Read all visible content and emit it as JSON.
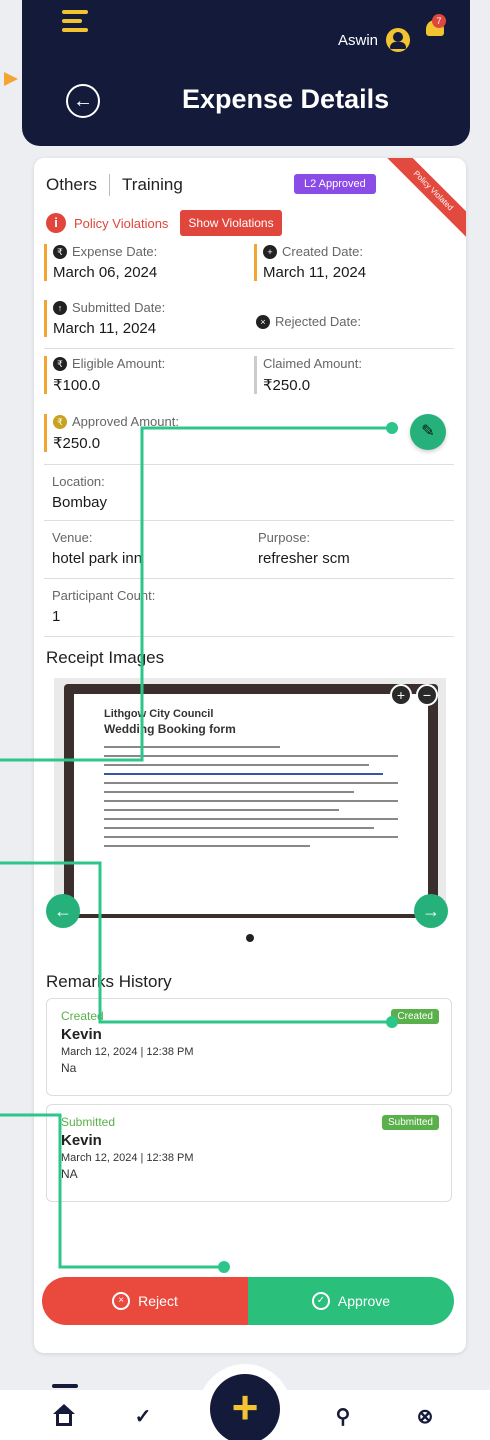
{
  "header": {
    "user_name": "Aswin",
    "notification_count": "7",
    "page_title": "Expense Details"
  },
  "expense": {
    "category": "Others",
    "type": "Training",
    "status": "L2 Approved",
    "ribbon": "Policy Violated",
    "policy_violations_label": "Policy Violations",
    "show_violations_label": "Show Violations",
    "expense_date_label": "Expense Date:",
    "expense_date": "March 06, 2024",
    "created_date_label": "Created Date:",
    "created_date": "March 11, 2024",
    "submitted_date_label": "Submitted Date:",
    "submitted_date": "March 11, 2024",
    "rejected_date_label": "Rejected Date:",
    "eligible_amount_label": "Eligible Amount:",
    "eligible_amount": "₹100.0",
    "claimed_amount_label": "Claimed Amount:",
    "claimed_amount": "₹250.0",
    "approved_amount_label": "Approved Amount:",
    "approved_amount": "₹250.0",
    "location_label": "Location:",
    "location": "Bombay",
    "venue_label": "Venue:",
    "venue": "hotel park inn",
    "purpose_label": "Purpose:",
    "purpose": "refresher scm",
    "participant_count_label": "Participant Count:",
    "participant_count": "1"
  },
  "receipts": {
    "title": "Receipt Images",
    "doc_org": "Lithgow City Council",
    "doc_title": "Wedding Booking form"
  },
  "remarks": {
    "title": "Remarks History",
    "items": [
      {
        "state": "Created",
        "name": "Kevin",
        "when": "March 12, 2024 | 12:38 PM",
        "note": "Na",
        "chip": "Created"
      },
      {
        "state": "Submitted",
        "name": "Kevin",
        "when": "March 12, 2024 | 12:38 PM",
        "note": "NA",
        "chip": "Submitted"
      }
    ]
  },
  "actions": {
    "reject_label": "Reject",
    "approve_label": "Approve"
  },
  "icons": {
    "menu": "hamburger-icon",
    "user": "user-circle-icon",
    "notifications": "bell-icon",
    "back": "arrow-left-icon",
    "edit": "pencil-icon",
    "zoom_in": "plus-circle-icon",
    "zoom_out": "minus-circle-icon",
    "home": "home-icon",
    "check": "check-badge-icon",
    "add": "plus-icon",
    "search": "search-icon",
    "close": "close-circle-icon"
  },
  "colors": {
    "navy": "#141a3a",
    "accent_yellow": "#f3c432",
    "danger": "#e0463b",
    "success": "#2bbf7c",
    "status_purple": "#8b4be6"
  }
}
